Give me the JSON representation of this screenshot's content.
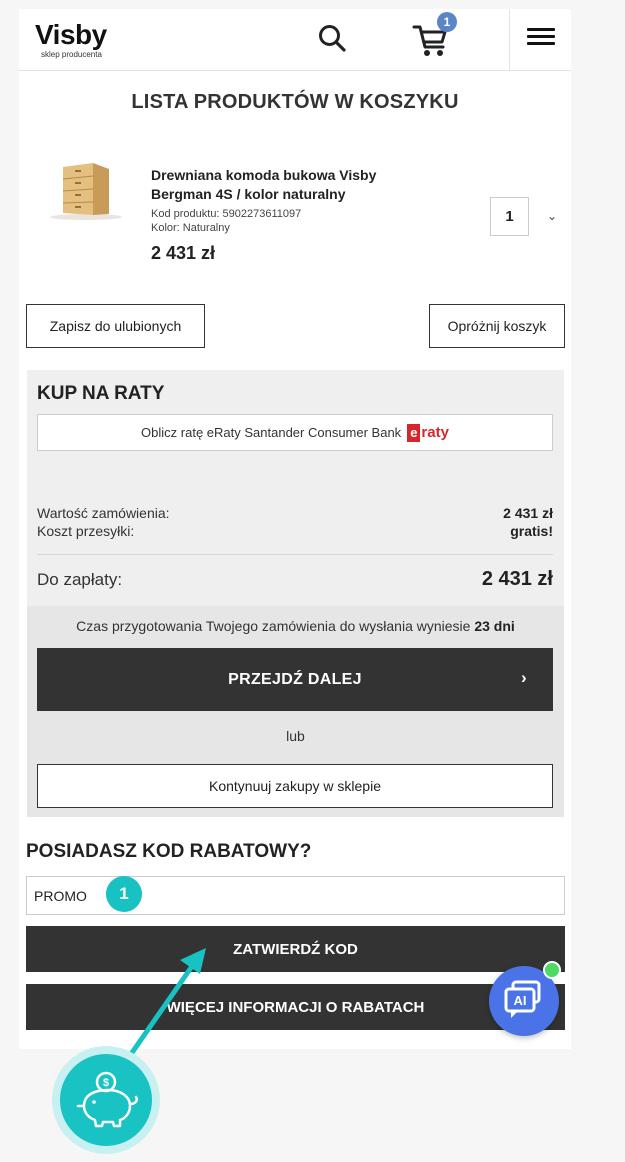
{
  "header": {
    "logo_text": "Visby",
    "logo_subtitle": "sklep producenta",
    "cart_count": "1",
    "icons": [
      "search-icon",
      "cart-icon",
      "hamburger-menu-icon"
    ]
  },
  "cart": {
    "title": "LISTA PRODUKTÓW W KOSZYKU",
    "item": {
      "name": "Drewniana komoda bukowa Visby Bergman 4S / kolor naturalny",
      "code": "Kod produktu: 5902273611097",
      "color": "Kolor: Naturalny",
      "price": "2 431 zł",
      "quantity": "1"
    },
    "save_favorites_label": "Zapisz do ulubionych",
    "empty_cart_label": "Opróżnij koszyk"
  },
  "installments": {
    "title": "KUP NA RATY",
    "calc_label": "Oblicz ratę eRaty Santander Consumer Bank",
    "logo_e": "e",
    "logo_rest": "raty"
  },
  "summary": {
    "order_value_label": "Wartość zamówienia:",
    "order_value": "2 431 zł",
    "shipping_label": "Koszt przesyłki:",
    "shipping_value": "gratis!",
    "total_label": "Do zapłaty:",
    "total_value": "2 431 zł"
  },
  "delivery": {
    "note_prefix": "Czas przygotowania Twojego zamówienia do wysłania wyniesie",
    "note_days": "23 dni",
    "proceed_label": "PRZEJDŹ DALEJ",
    "or_label": "lub",
    "continue_label": "Kontynuuj zakupy w sklepie"
  },
  "promo": {
    "title": "POSIADASZ KOD RABATOWY?",
    "input_value": "PROMO",
    "step_number": "1",
    "confirm_label": "ZATWIERDŹ KOD",
    "more_info_label": "WIĘCEJ INFORMACJI O RABATACH"
  },
  "chat": {
    "label": "AI",
    "status_color": "#4cd964"
  },
  "colors": {
    "accent_teal": "#18c2c2",
    "dark_button": "#333333",
    "cart_badge": "#5b86c5",
    "chat_blue": "#4a73e8",
    "eraty_red": "#d6262b"
  }
}
